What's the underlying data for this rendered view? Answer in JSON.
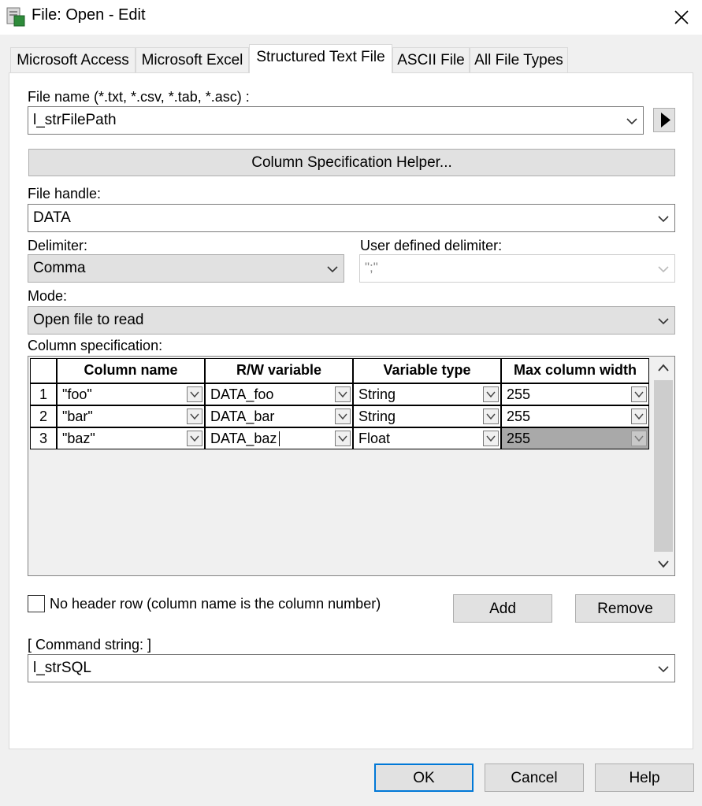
{
  "window": {
    "title": "File: Open - Edit"
  },
  "tabs": [
    {
      "label": "Microsoft Access"
    },
    {
      "label": "Microsoft Excel"
    },
    {
      "label": "Structured Text File"
    },
    {
      "label": "ASCII File"
    },
    {
      "label": "All File Types"
    }
  ],
  "file_name": {
    "label": "File name (*.txt, *.csv, *.tab, *.asc) :",
    "value": "l_strFilePath"
  },
  "helper_button": "Column Specification Helper...",
  "file_handle": {
    "label": "File handle:",
    "value": "DATA"
  },
  "delimiter": {
    "label": "Delimiter:",
    "value": "Comma"
  },
  "user_delimiter": {
    "label": "User defined delimiter:",
    "value": "\";\""
  },
  "mode": {
    "label": "Mode:",
    "value": "Open file to read"
  },
  "column_spec": {
    "label": "Column specification:",
    "headers": [
      "Column name",
      "R/W variable",
      "Variable type",
      "Max column width"
    ],
    "rows": [
      {
        "num": "1",
        "name": "\"foo\"",
        "var": "DATA_foo",
        "type": "String",
        "width": "255"
      },
      {
        "num": "2",
        "name": "\"bar\"",
        "var": "DATA_bar",
        "type": "String",
        "width": "255"
      },
      {
        "num": "3",
        "name": "\"baz\"",
        "var": "DATA_baz",
        "type": "Float",
        "width": "255"
      }
    ]
  },
  "no_header": {
    "label": "No header row (column name is the column number)",
    "checked": false
  },
  "add_button": "Add",
  "remove_button": "Remove",
  "command_string": {
    "label": "[ Command string: ]",
    "value": "l_strSQL"
  },
  "footer": {
    "ok": "OK",
    "cancel": "Cancel",
    "help": "Help"
  }
}
